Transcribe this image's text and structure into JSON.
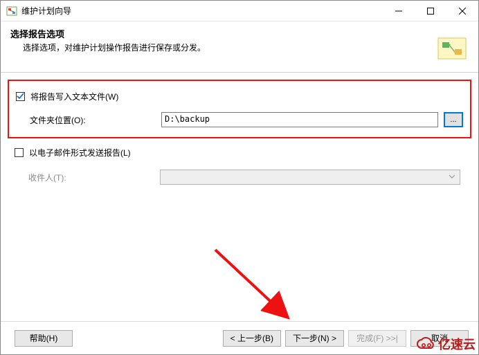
{
  "window": {
    "title": "维护计划向导"
  },
  "header": {
    "title": "选择报告选项",
    "subtitle": "选择选项，对维护计划操作报告进行保存或分发。"
  },
  "writeFile": {
    "checkbox_label": "将报告写入文本文件(W)",
    "checked": true,
    "folder_label": "文件夹位置(O):",
    "folder_value": "D:\\backup",
    "browse_label": "..."
  },
  "email": {
    "checkbox_label": "以电子邮件形式发送报告(L)",
    "checked": false,
    "recipient_label": "收件人(T):",
    "recipient_value": ""
  },
  "buttons": {
    "help": "帮助(H)",
    "back": "< 上一步(B)",
    "next": "下一步(N) >",
    "finish": "完成(F) >>|",
    "cancel": "取消"
  },
  "watermark": "亿速云"
}
